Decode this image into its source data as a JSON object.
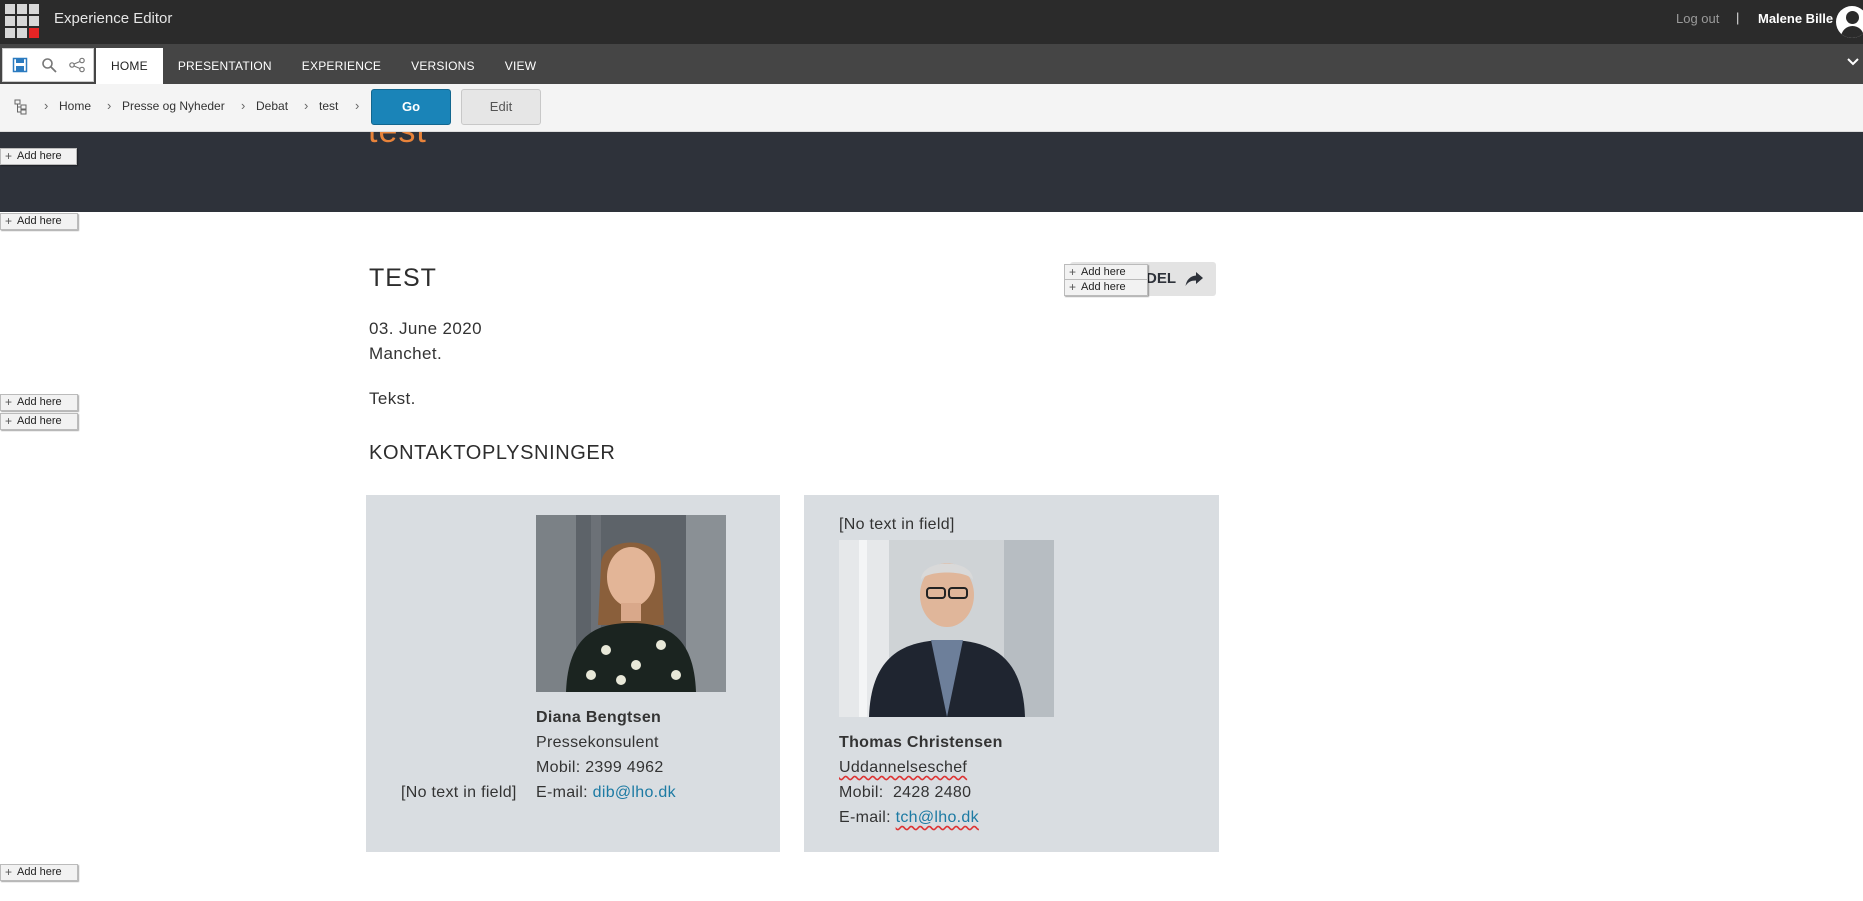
{
  "app": {
    "title": "Experience Editor"
  },
  "user": {
    "logout_label": "Log out",
    "separator": "|",
    "name": "Malene Bille"
  },
  "ribbon": {
    "tabs": [
      "HOME",
      "PRESENTATION",
      "EXPERIENCE",
      "VERSIONS",
      "VIEW"
    ],
    "active_tab": "HOME"
  },
  "breadcrumb": {
    "items": [
      "Home",
      "Presse og Nyheder",
      "Debat",
      "test"
    ]
  },
  "nav": {
    "go_label": "Go",
    "edit_label": "Edit"
  },
  "hero": {
    "title": "test"
  },
  "placeholder": {
    "add_here": "Add here"
  },
  "article": {
    "title": "TEST",
    "share_label": "DEL",
    "date": "03. June 2020",
    "manchet": "Manchet.",
    "text": "Tekst."
  },
  "contacts": {
    "section_title": "KONTAKTOPLYSNINGER",
    "empty_field": "[No text in field]",
    "cards": [
      {
        "name": "Diana Bengtsen",
        "role": "Pressekonsulent",
        "phone": "Mobil: 2399 4962",
        "email_label": "E-mail: ",
        "email": "dib@lho.dk"
      },
      {
        "name": "Thomas Christensen",
        "role": "Uddannelseschef",
        "phone": "Mobil:  2428 2480",
        "email_label": "E-mail: ",
        "email": "tch@lho.dk"
      }
    ]
  },
  "colors": {
    "topbar": "#2b2b2b",
    "ribbon": "#454545",
    "go_button": "#1a84b8",
    "hero": "#2e323a",
    "hero_title": "#e8833a",
    "card": "#d9dde1",
    "link": "#1c7aa3"
  }
}
